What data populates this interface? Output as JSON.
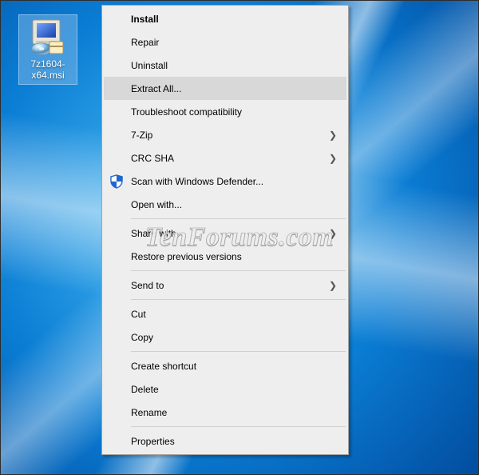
{
  "desktop": {
    "icon_label": "7z1604-x64.msi"
  },
  "watermark": "TenForums.com",
  "menu": {
    "install": "Install",
    "repair": "Repair",
    "uninstall": "Uninstall",
    "extract_all": "Extract All...",
    "troubleshoot": "Troubleshoot compatibility",
    "seven_zip": "7-Zip",
    "crc_sha": "CRC SHA",
    "defender": "Scan with Windows Defender...",
    "open_with": "Open with...",
    "share_with": "Share with",
    "restore": "Restore previous versions",
    "send_to": "Send to",
    "cut": "Cut",
    "copy": "Copy",
    "create_shortcut": "Create shortcut",
    "delete": "Delete",
    "rename": "Rename",
    "properties": "Properties"
  }
}
